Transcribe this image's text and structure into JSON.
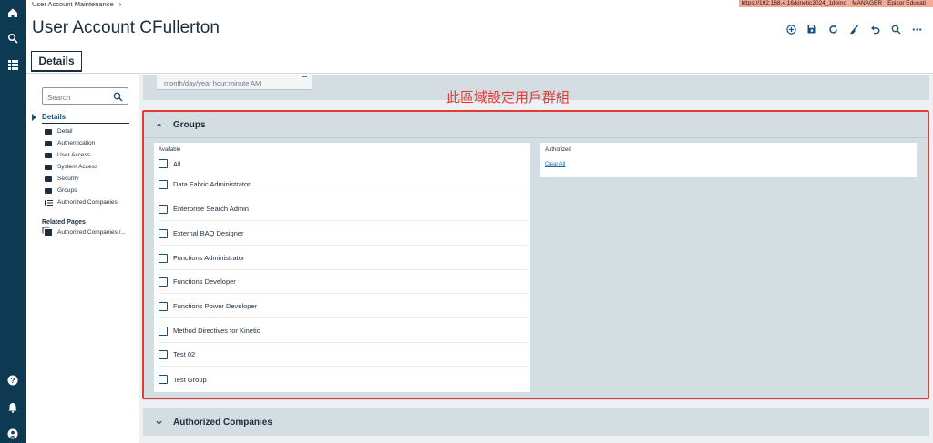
{
  "topbar": {
    "breadcrumb": "User Account Maintenance",
    "breadcrumb_sep": "›",
    "url": "https://192.168.4.16/kinetic2024_1demo",
    "user": "MANAGER",
    "company": "Epicor Educati"
  },
  "page": {
    "title": "User Account CFullerton",
    "tab_label": "Details"
  },
  "toolbar": {
    "icons": [
      "add-icon",
      "save-icon",
      "refresh-icon",
      "clear-icon",
      "undo-icon",
      "search-icon",
      "more-icon"
    ]
  },
  "rail": {
    "icons": [
      "home-icon",
      "search-icon",
      "apps-icon",
      "help-icon",
      "notifications-icon",
      "user-icon"
    ]
  },
  "sidenav": {
    "search_placeholder": "Search",
    "section": "Details",
    "items": [
      {
        "label": "Detail"
      },
      {
        "label": "Authentication"
      },
      {
        "label": "User Access"
      },
      {
        "label": "System Access"
      },
      {
        "label": "Security"
      },
      {
        "label": "Groups"
      },
      {
        "label": "Authorized Companies"
      }
    ],
    "related_heading": "Related Pages",
    "related_item": "Authorized Companies /..."
  },
  "date_field": {
    "placeholder": "month/day/year hour:minute AM"
  },
  "groups": {
    "title": "Groups",
    "available_label": "Available",
    "all_label": "All",
    "available_items": [
      "Data Fabric Administrator",
      "Enterprise Search Admin",
      "External BAQ Designer",
      "Functions Administrator",
      "Functions Developer",
      "Functions Power Developer",
      "Method Directives for Kinetic",
      "Test 02",
      "Test Group"
    ],
    "authorized_label": "Authorized",
    "clear_all_label": "Clear All"
  },
  "authorized_companies": {
    "title": "Authorized Companies"
  },
  "annotation": {
    "text": "此區域設定用戶群組",
    "color": "#e53935"
  }
}
